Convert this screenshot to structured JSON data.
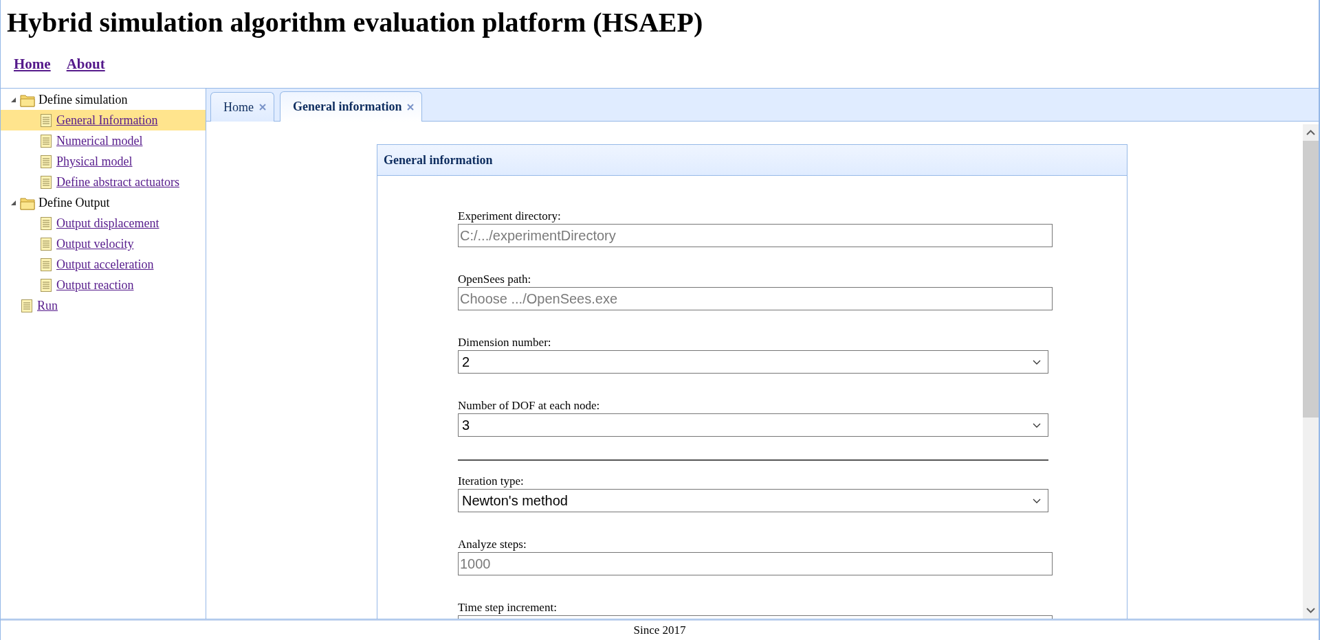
{
  "header": {
    "title": "Hybrid simulation algorithm evaluation platform (HSAEP)",
    "nav": [
      {
        "label": "Home"
      },
      {
        "label": "About"
      }
    ]
  },
  "sidebar": {
    "tree": [
      {
        "kind": "folder",
        "label": "Define simulation",
        "expanded": true,
        "selected": false,
        "children": [
          {
            "kind": "page",
            "label": "General Information",
            "selected": true
          },
          {
            "kind": "page",
            "label": "Numerical model",
            "selected": false
          },
          {
            "kind": "page",
            "label": "Physical model",
            "selected": false
          },
          {
            "kind": "page",
            "label": "Define abstract actuators",
            "selected": false
          }
        ]
      },
      {
        "kind": "folder",
        "label": "Define Output",
        "expanded": true,
        "selected": false,
        "children": [
          {
            "kind": "page",
            "label": "Output displacement",
            "selected": false
          },
          {
            "kind": "page",
            "label": "Output velocity",
            "selected": false
          },
          {
            "kind": "page",
            "label": "Output acceleration",
            "selected": false
          },
          {
            "kind": "page",
            "label": "Output reaction",
            "selected": false
          }
        ]
      },
      {
        "kind": "page",
        "label": "Run",
        "selected": false
      }
    ]
  },
  "tabs": [
    {
      "label": "Home",
      "selected": false
    },
    {
      "label": "General information",
      "selected": true
    }
  ],
  "panel": {
    "title": "General information",
    "fields": [
      {
        "kind": "text",
        "label": "Experiment directory:",
        "placeholder": "C:/.../experimentDirectory"
      },
      {
        "kind": "text",
        "label": "OpenSees path:",
        "placeholder": "Choose .../OpenSees.exe"
      },
      {
        "kind": "select",
        "label": "Dimension number:",
        "value": "2"
      },
      {
        "kind": "select",
        "label": "Number of DOF at each node:",
        "value": "3"
      },
      {
        "kind": "divider"
      },
      {
        "kind": "select",
        "label": "Iteration type:",
        "value": "Newton's method"
      },
      {
        "kind": "text",
        "label": "Analyze steps:",
        "placeholder": "1000"
      },
      {
        "kind": "text",
        "label": "Time step increment:"
      }
    ]
  },
  "footer": {
    "text": "Since 2017"
  }
}
